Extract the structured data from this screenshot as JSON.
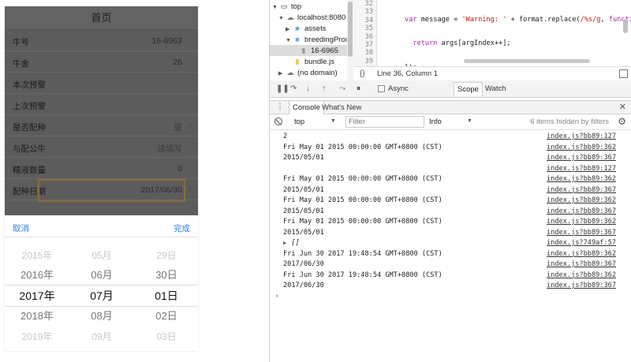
{
  "phone": {
    "title": "首页",
    "rows": [
      {
        "label": "牛号",
        "value": "16-6963"
      },
      {
        "label": "牛舍",
        "value": "26"
      },
      {
        "label": "本次预警",
        "value": ""
      },
      {
        "label": "上次预警",
        "value": ""
      },
      {
        "label": "是否配种",
        "value": "是"
      },
      {
        "label": "与配公牛",
        "value": "请填写"
      },
      {
        "label": "精液数量",
        "value": "0"
      },
      {
        "label": "配种日期",
        "value": "2017/06/30"
      }
    ],
    "picker": {
      "cancel_label": "取消",
      "done_label": "完成",
      "years": [
        "2015年",
        "2016年",
        "2017年",
        "2018年",
        "2019年"
      ],
      "months": [
        "05月",
        "06月",
        "07月",
        "08月",
        "09月"
      ],
      "days": [
        "29日",
        "30日",
        "01日",
        "02日",
        "03日"
      ]
    }
  },
  "devtools": {
    "tree": {
      "top": "top",
      "localhost": "localhost:8080",
      "assets": "assets",
      "breeding": "breedingProce",
      "file": "16-6965",
      "bundle": "bundle.js",
      "nodomain": "(no domain)"
    },
    "code": {
      "line_numbers": [
        "32",
        "33",
        "34",
        "35",
        "36",
        "37",
        "38",
        "39",
        "40"
      ]
    },
    "status": {
      "braces": "{}",
      "position": "Line 36, Column 1"
    },
    "debugger": {
      "async_label": "Async",
      "scope_tab": "Scope",
      "watch_tab": "Watch"
    },
    "drawer": {
      "console_tab": "Console",
      "whatsnew_tab": "What's New"
    },
    "console_toolbar": {
      "context": "top",
      "filter_placeholder": "Filter",
      "level": "Info",
      "hidden_text": "6 items hidden by filters"
    },
    "log": [
      {
        "msg": "2",
        "src": "index.js?bb89:127"
      },
      {
        "msg": "Fri May 01 2015 00:00:00 GMT+0800 (CST)",
        "src": "index.js?bb89:362"
      },
      {
        "msg": "2015/05/01",
        "src": "index.js?bb89:367"
      },
      {
        "msg": "",
        "src": "index.js?bb89:127"
      },
      {
        "msg": "Fri May 01 2015 00:00:00 GMT+0800 (CST)",
        "src": "index.js?bb89:362"
      },
      {
        "msg": "2015/05/01",
        "src": "index.js?bb89:367"
      },
      {
        "msg": "Fri May 01 2015 00:00:00 GMT+0800 (CST)",
        "src": "index.js?bb89:362"
      },
      {
        "msg": "2015/05/01",
        "src": "index.js?bb89:367"
      },
      {
        "msg": "Fri May 01 2015 00:00:00 GMT+0800 (CST)",
        "src": "index.js?bb89:362"
      },
      {
        "msg": "2015/05/01",
        "src": "index.js?bb89:367"
      },
      {
        "msg": "  []",
        "src": "index.js?749af:57"
      },
      {
        "msg": "Fri Jun 30 2017 19:48:54 GMT+0800 (CST)",
        "src": "index.js?bb89:362"
      },
      {
        "msg": "2017/06/30",
        "src": "index.js?bb89:367"
      },
      {
        "msg": "Fri Jun 30 2017 19:48:54 GMT+0800 (CST)",
        "src": "index.js?bb89:362"
      },
      {
        "msg": "2017/06/30",
        "src": "index.js?bb89:367"
      }
    ],
    "prompt": "›"
  }
}
